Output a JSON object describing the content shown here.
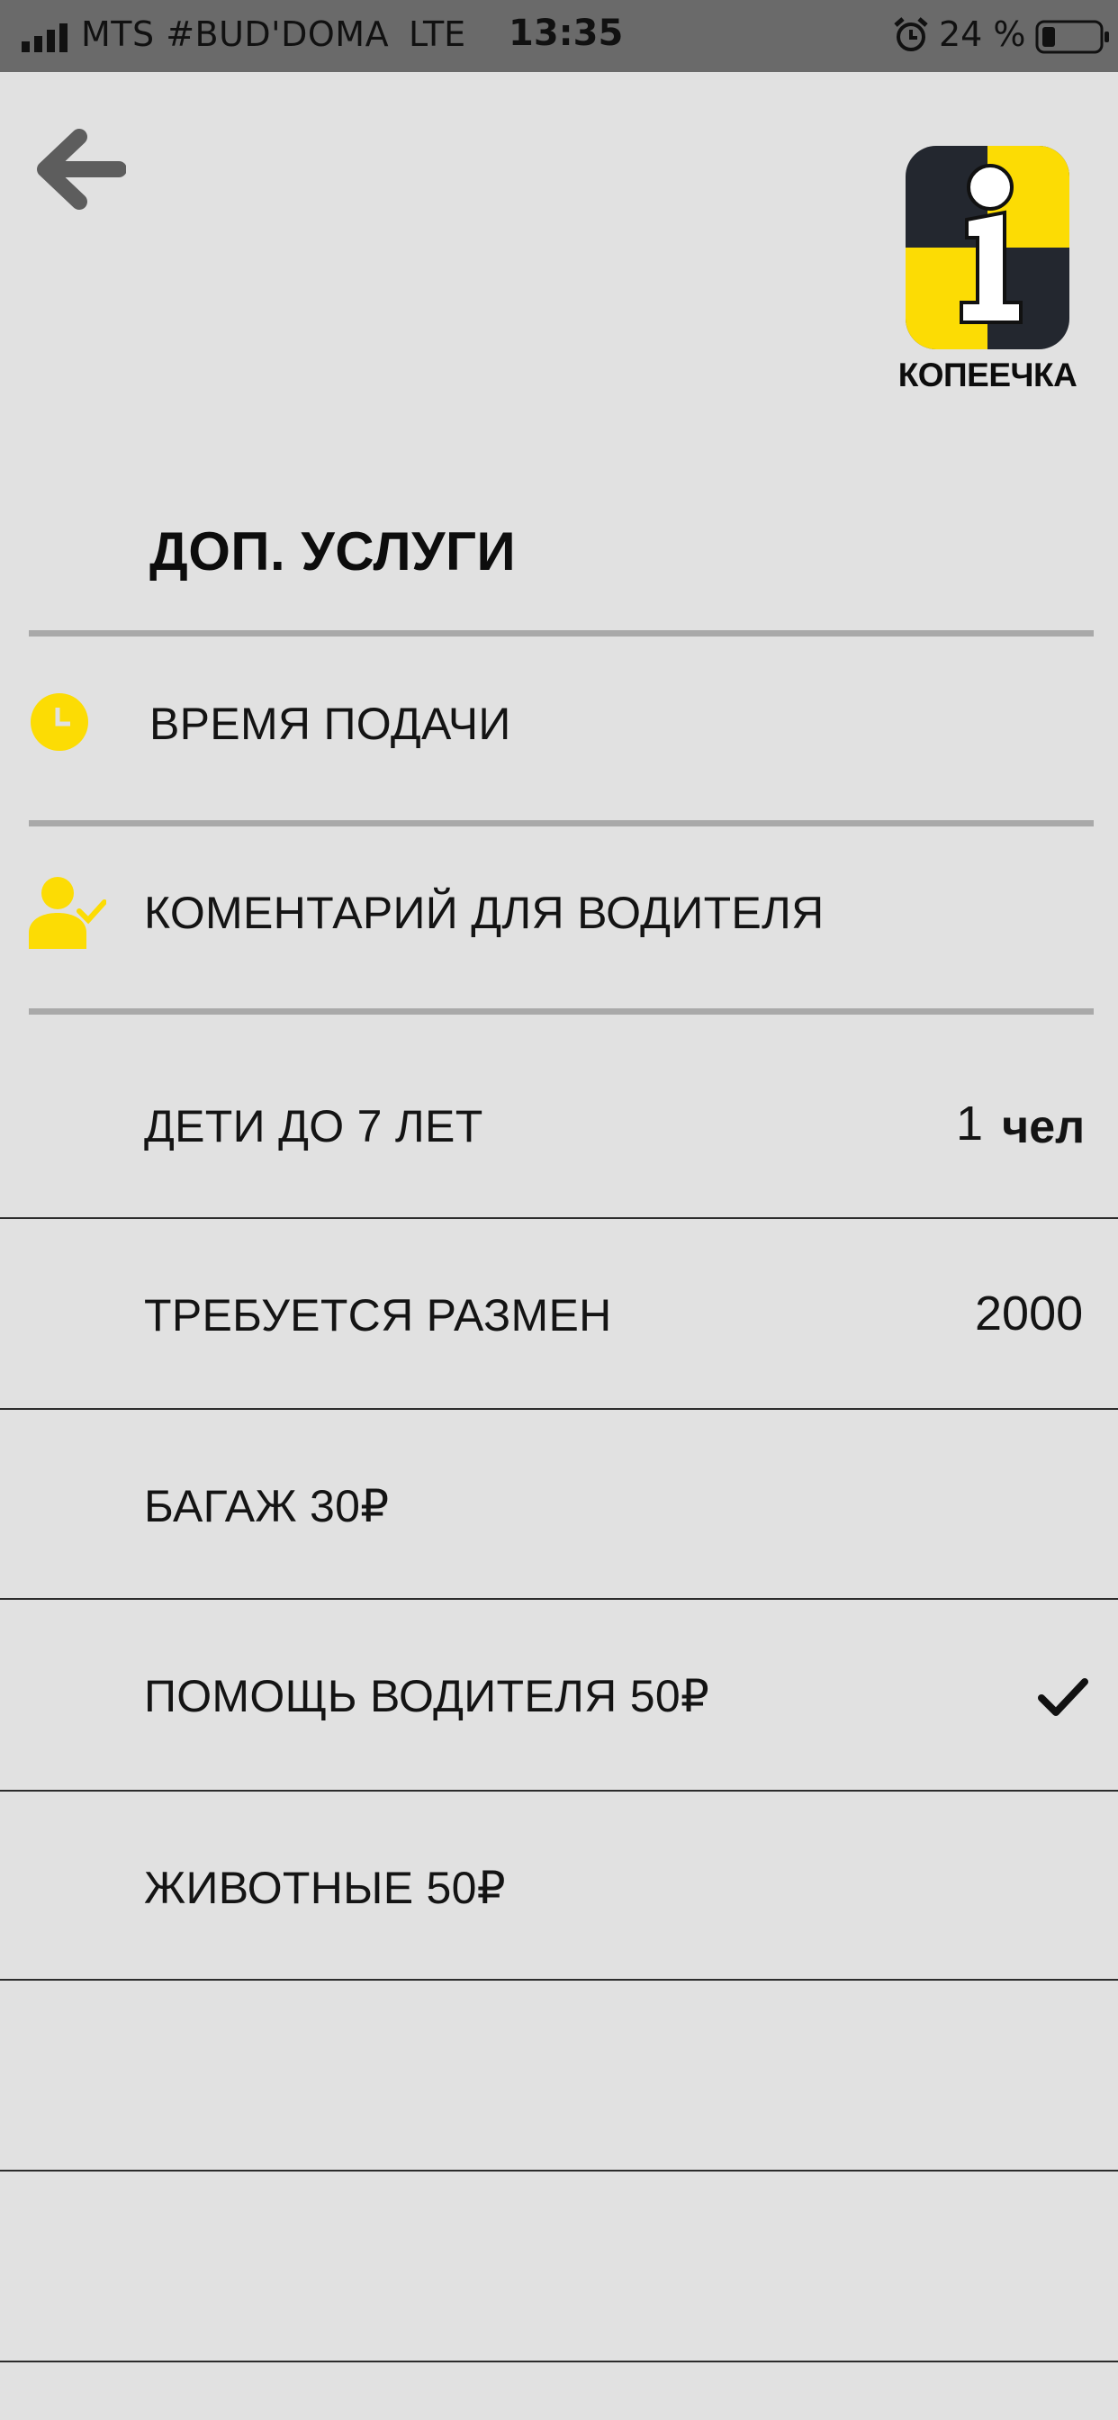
{
  "status_bar": {
    "carrier": "MTS #BUD'DOMA",
    "network": "LTE",
    "time": "13:35",
    "battery": "24 %"
  },
  "header": {
    "back_icon": "arrow-left-icon",
    "logo_icon": "kopeechka-logo",
    "logo_text": "КОПЕЕЧКА"
  },
  "section_title": "ДОП. УСЛУГИ",
  "menu": {
    "pickup_time": {
      "icon": "clock-icon",
      "label": "ВРЕМЯ ПОДАЧИ"
    },
    "driver_comment": {
      "icon": "user-check-icon",
      "label": "КОМЕНТАРИЙ ДЛЯ ВОДИТЕЛЯ"
    }
  },
  "options": [
    {
      "label": "ДЕТИ ДО 7 ЛЕТ",
      "value": "1",
      "unit": "чел"
    },
    {
      "label": "ТРЕБУЕТСЯ РАЗМЕН",
      "value": "2000"
    },
    {
      "label": "БАГАЖ 30₽"
    },
    {
      "label": "ПОМОЩЬ ВОДИТЕЛЯ 50₽",
      "checked": true
    },
    {
      "label": "ЖИВОТНЫЕ 50₽"
    }
  ],
  "colors": {
    "accent": "#fcdc04",
    "background": "#e1e1e1",
    "status_bar": "#6a6a6a"
  }
}
